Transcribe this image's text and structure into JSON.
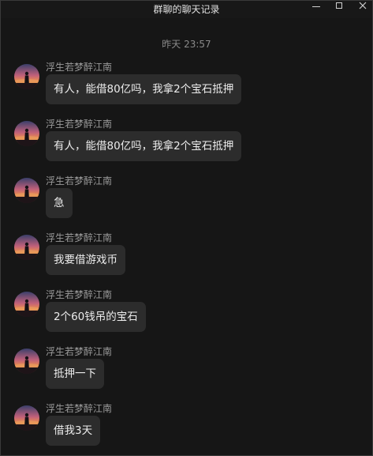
{
  "window": {
    "title": "群聊的聊天记录"
  },
  "timestamp": "昨天 23:57",
  "messages": [
    {
      "sender": "浮生若梦醉江南",
      "text": "有人，能借80亿吗，我拿2个宝石抵押"
    },
    {
      "sender": "浮生若梦醉江南",
      "text": "有人，能借80亿吗，我拿2个宝石抵押"
    },
    {
      "sender": "浮生若梦醉江南",
      "text": "急"
    },
    {
      "sender": "浮生若梦醉江南",
      "text": "我要借游戏币"
    },
    {
      "sender": "浮生若梦醉江南",
      "text": "2个60钱吊的宝石"
    },
    {
      "sender": "浮生若梦醉江南",
      "text": "抵押一下"
    },
    {
      "sender": "浮生若梦醉江南",
      "text": "借我3天"
    }
  ],
  "icons": {
    "minimize": "minimize-icon",
    "maximize": "maximize-icon",
    "close": "close-icon",
    "avatar": "sunset-avatar"
  }
}
